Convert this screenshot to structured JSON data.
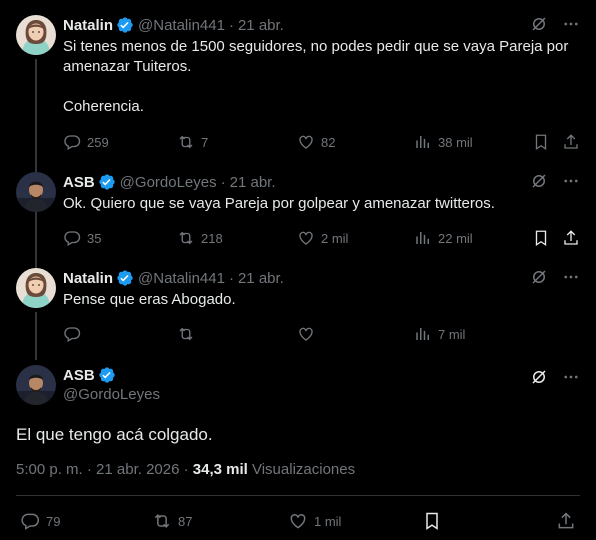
{
  "tweets": [
    {
      "name": "Natalin",
      "handle": "@Natalin441",
      "date": "21 abr.",
      "text": "Si tenes menos de 1500 seguidores, no podes pedir que se vaya Pareja por amenazar Tuiteros.\n\nCoherencia.",
      "replies": "259",
      "retweets": "7",
      "likes": "82",
      "views": "38 mil"
    },
    {
      "name": "ASB",
      "handle": "@GordoLeyes",
      "date": "21 abr.",
      "text": "Ok. Quiero que se vaya Pareja por golpear y amenazar twitteros.",
      "replies": "35",
      "retweets": "218",
      "likes": "2 mil",
      "views": "22 mil"
    },
    {
      "name": "Natalin",
      "handle": "@Natalin441",
      "date": "21 abr.",
      "text": "Pense que eras Abogado.",
      "replies": "",
      "retweets": "",
      "likes": "",
      "views": "7 mil"
    }
  ],
  "main": {
    "name": "ASB",
    "handle": "@GordoLeyes",
    "text": "El que tengo acá colgado.",
    "time": "5:00 p. m. · 21 abr. 2026 · ",
    "views_count": "34,3 mil",
    "views_label": " Visualizaciones",
    "replies": "79",
    "retweets": "87",
    "likes": "1 mil"
  },
  "colors": {
    "accent": "#1d9bf0",
    "muted": "#71767b",
    "text": "#e7e9ea",
    "background": "#000000"
  },
  "icons": [
    "verified-badge-icon",
    "grok-icon",
    "more-icon",
    "reply-icon",
    "retweet-icon",
    "like-icon",
    "views-icon",
    "bookmark-icon",
    "share-icon"
  ]
}
